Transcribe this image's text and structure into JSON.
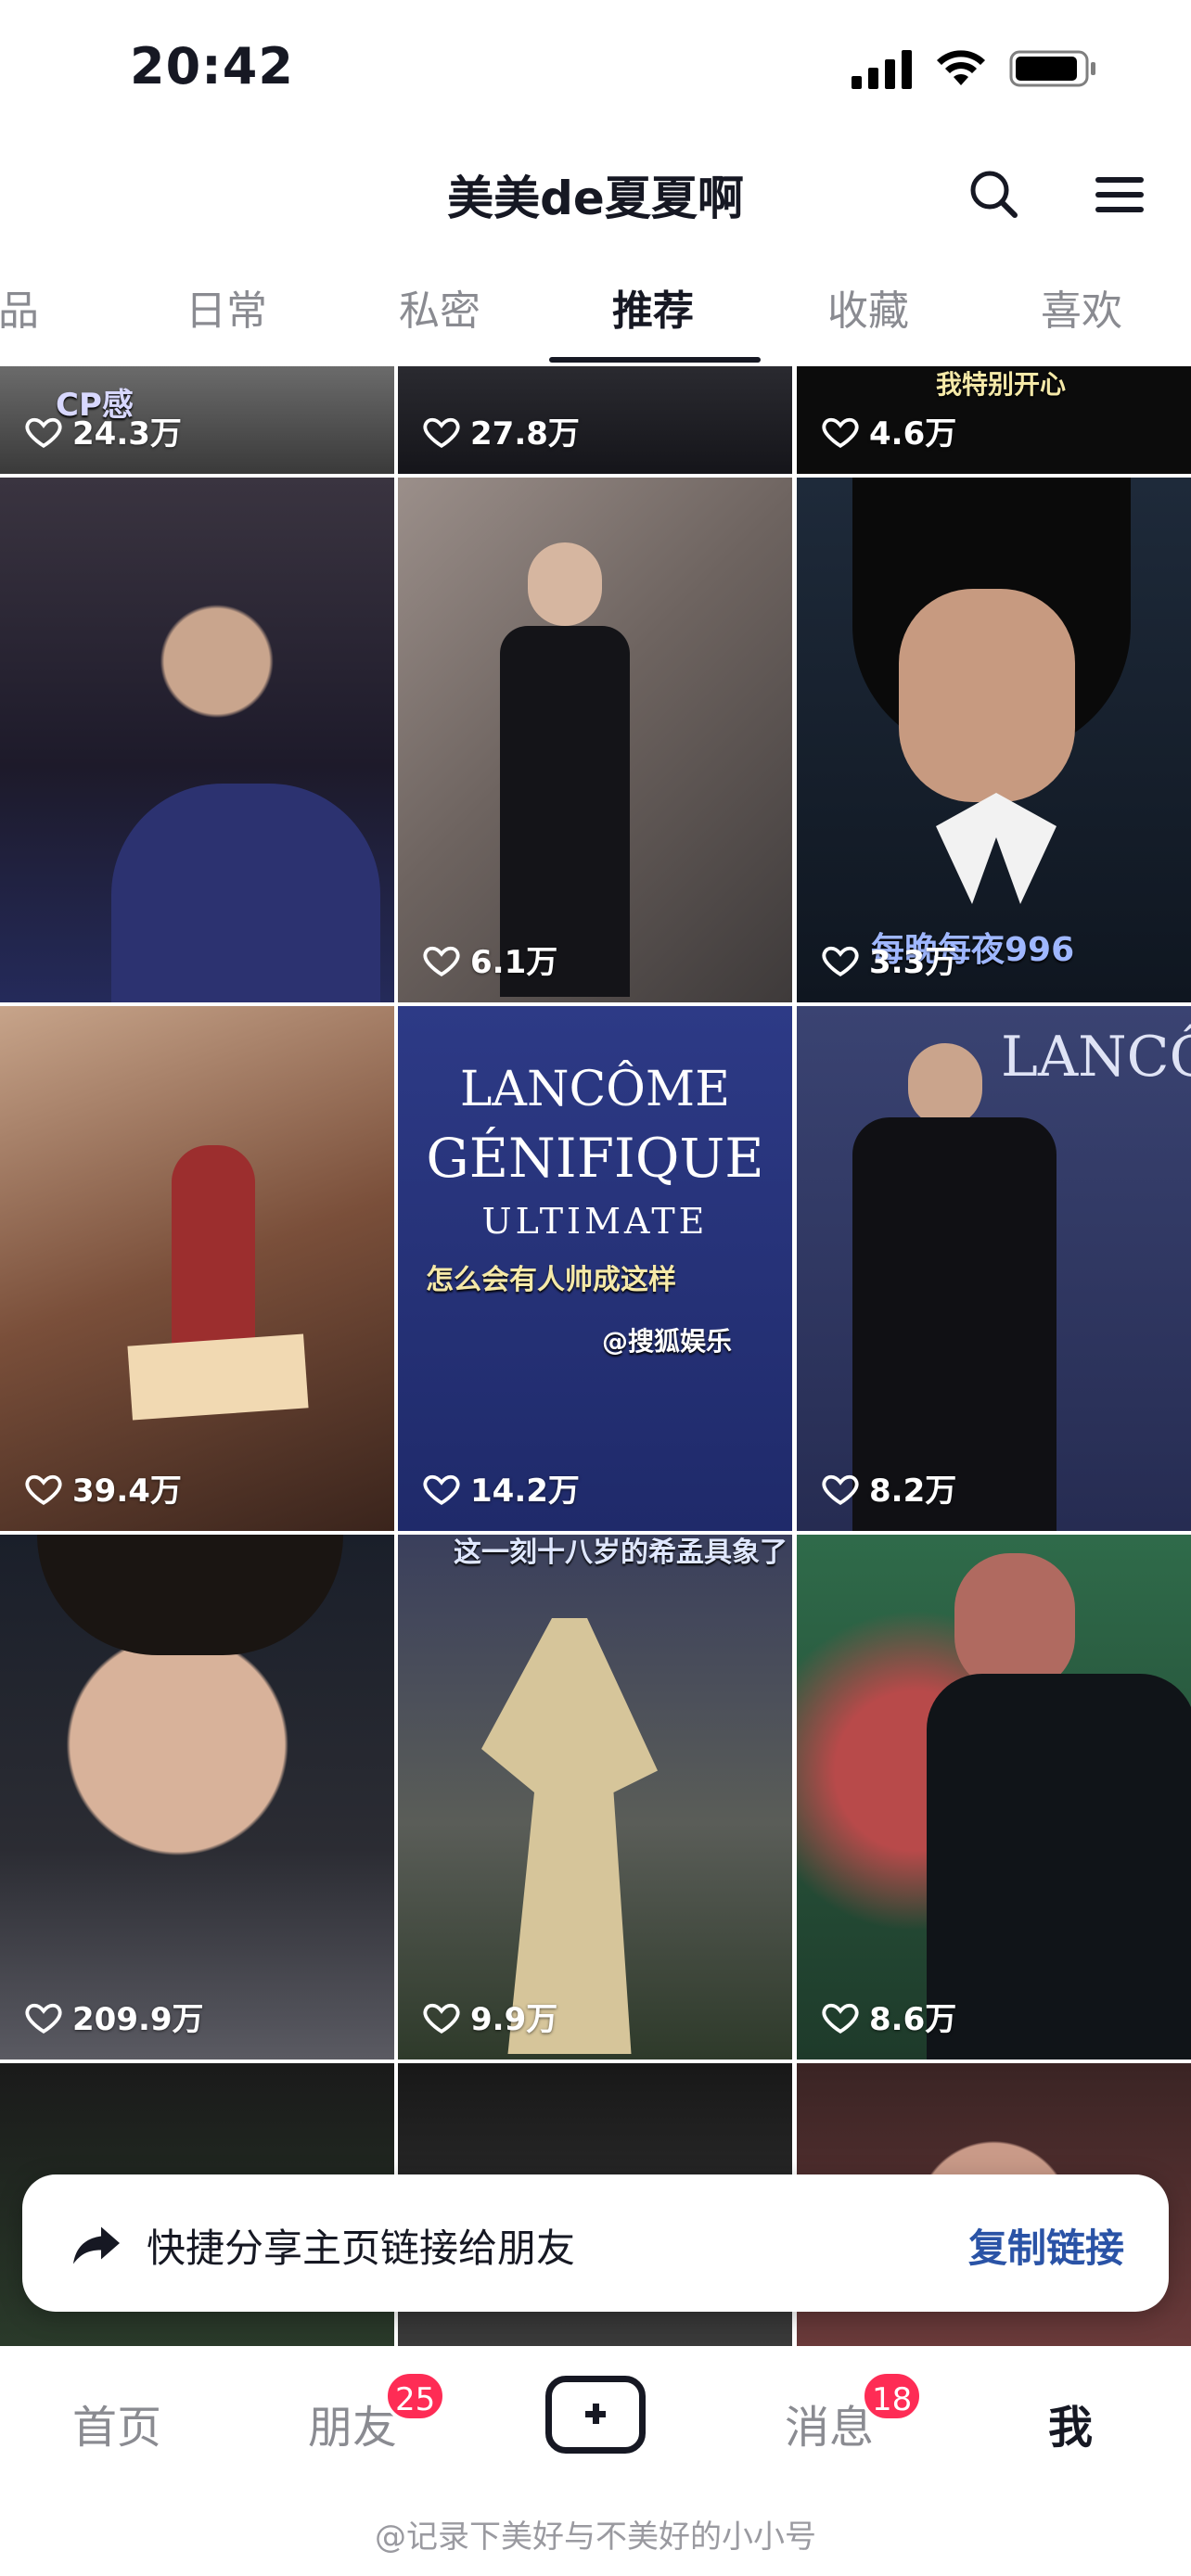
{
  "status_bar": {
    "time": "20:42"
  },
  "header": {
    "title": "美美de夏夏啊"
  },
  "tabs": [
    "作品",
    "日常",
    "私密",
    "推荐",
    "收藏",
    "喜欢"
  ],
  "active_tab": "推荐",
  "videos": [
    {
      "likes": "24.3万",
      "caption": "CP感"
    },
    {
      "likes": "27.8万"
    },
    {
      "likes": "4.6万",
      "caption": "我特别开心"
    },
    {
      "likes": ""
    },
    {
      "likes": "6.1万"
    },
    {
      "likes": "3.3万",
      "caption": "每晚每夜996"
    },
    {
      "likes": "39.4万"
    },
    {
      "likes": "14.2万",
      "caption": "怎么会有人帅成这样",
      "tag": "@搜狐娱乐",
      "brand1": "LANCÔME",
      "brand2": "GÉNIFIQUE",
      "brand3": "ULTIMATE"
    },
    {
      "likes": "8.2万",
      "brand1": "LANCÔME"
    },
    {
      "likes": "209.9万"
    },
    {
      "likes": "9.9万",
      "caption": "这一刻十八岁的希孟具象了"
    },
    {
      "likes": "8.6万"
    },
    {
      "likes": ""
    },
    {
      "likes": ""
    },
    {
      "likes": ""
    }
  ],
  "share_banner": {
    "text": "快捷分享主页链接给朋友",
    "action": "复制链接"
  },
  "bottom_nav": [
    {
      "label": "首页"
    },
    {
      "label": "朋友",
      "badge": "25"
    },
    {
      "label": "create"
    },
    {
      "label": "消息",
      "badge": "18"
    },
    {
      "label": "我"
    }
  ],
  "watermark": "@记录下美好与不美好的小小号",
  "colors": {
    "accent": "#fe2c55",
    "link": "#2a53a6",
    "text": "#161823",
    "muted": "#8a8b91"
  }
}
